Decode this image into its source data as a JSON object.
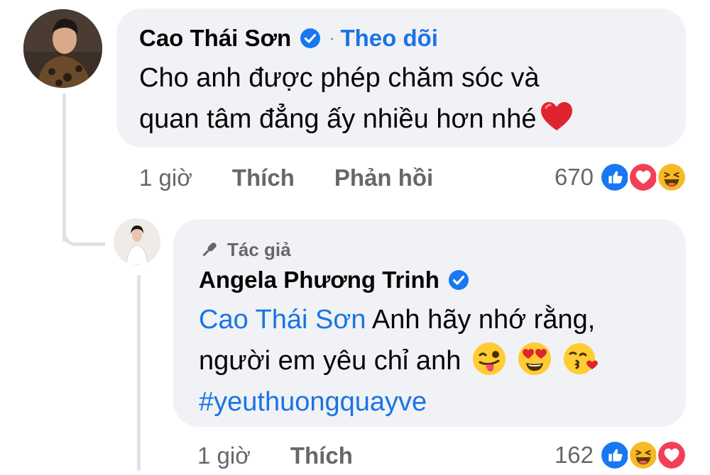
{
  "comment": {
    "author": "Cao Thái Sơn",
    "separator": "·",
    "follow_label": "Theo dõi",
    "text_line1": "Cho anh được phép chăm sóc và",
    "text_line2": "quan tâm đẳng ấy nhiều hơn nhé",
    "trailing_icon": "red-heart-emoji",
    "time": "1 giờ",
    "like_label": "Thích",
    "reply_label": "Phản hồi",
    "reaction_count": "670",
    "reactions": [
      "like",
      "love",
      "haha"
    ]
  },
  "reply": {
    "badge_icon": "microphone-icon",
    "badge_label": "Tác giả",
    "author": "Angela Phương Trinh",
    "mention": "Cao Thái Sơn",
    "text_line1": " Anh hãy nhớ rằng,",
    "text_line2": "người em yêu chỉ anh",
    "trailing_emojis": [
      "winking-tongue-emoji",
      "heart-eyes-emoji",
      "kissing-heart-emoji"
    ],
    "hashtag": "#yeuthuongquayve",
    "time": "1 giờ",
    "like_label": "Thích",
    "reaction_count": "162",
    "reactions": [
      "like",
      "haha",
      "love"
    ]
  },
  "colors": {
    "link_blue": "#1b74e4",
    "bubble_bg": "#f0f2f5",
    "meta_gray": "#65676b",
    "like_blue": "#1877f2",
    "love_red": "#f33e58",
    "haha_yellow": "#f7b928"
  }
}
